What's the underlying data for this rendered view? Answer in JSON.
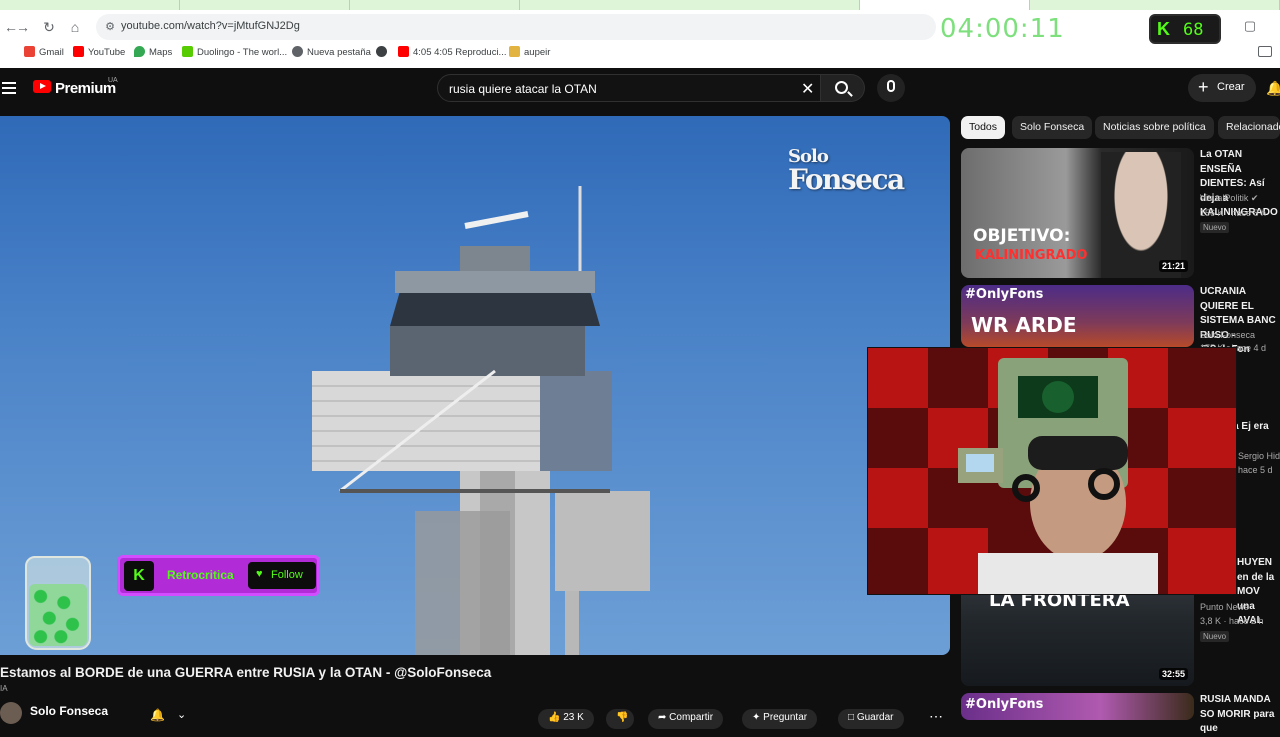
{
  "browser": {
    "url": "youtube.com/watch?v=jMtufGNJ2Dg",
    "timer": "04:00:11",
    "kick_count": "68",
    "bookmarks": [
      "Gmail",
      "YouTube",
      "Maps",
      "Duolingo - The worl...",
      "Nueva pestaña",
      "",
      "4:05 4:05 Reproduci...",
      "aupeir"
    ]
  },
  "header": {
    "brand": "Premium",
    "region": "UA",
    "search_query": "rusia quiere atacar la OTAN",
    "create_label": "Crear"
  },
  "player": {
    "watermark_line1": "Solo",
    "watermark_line2": "Fonseca",
    "kick_channel": "Retrocritica",
    "follow_label": "Follow"
  },
  "video": {
    "title": "Estamos al BORDE de una GUERRA entre RUSIA y la OTAN - @SoloFonseca",
    "ia_label": "IA",
    "channel": "Solo Fonseca",
    "likes": "23 K",
    "share_label": "Compartir",
    "ask_label": "Preguntar",
    "save_label": "Guardar"
  },
  "chips": [
    "Todos",
    "Solo Fonseca",
    "Noticias sobre política",
    "Relacionado"
  ],
  "recommendations": [
    {
      "title": "La OTAN ENSEÑA DIENTES: Así deja a KALININGRADO",
      "channel": "VisualPolitik",
      "views": "156 K",
      "age": "hace 8 h",
      "badge": "Nuevo",
      "duration": "21:21",
      "overlay": "OBJETIVO:",
      "overlay2": "KALININGRADO"
    },
    {
      "title": "UCRANIA QUIERE EL SISTEMA BANC RUSO - @SoloFon",
      "channel": "Solo Fonseca",
      "views": "175 K",
      "age": "hace 4 d",
      "overlay": "#OnlyFons",
      "overlay2": "WR ARDE"
    },
    {
      "title": "N Activa Ej era rusa",
      "channel": "Sergio Hida",
      "age": "hace 5 d"
    },
    {
      "title": "HUYEN en de la MOV una AVAL",
      "channel": "Punto News",
      "views": "3,8 K",
      "age": "hace 2 h",
      "badge": "Nuevo",
      "duration": "32:55",
      "overlay": "LA FRONTERA"
    },
    {
      "title": "RUSIA MANDA SO MORIR para que",
      "overlay": "#OnlyFons"
    }
  ],
  "colors": {
    "youtube_red": "#ff0000",
    "kick_green": "#53fc18",
    "timer_green": "#7de07d",
    "kick_purple": "#b12cd6"
  }
}
